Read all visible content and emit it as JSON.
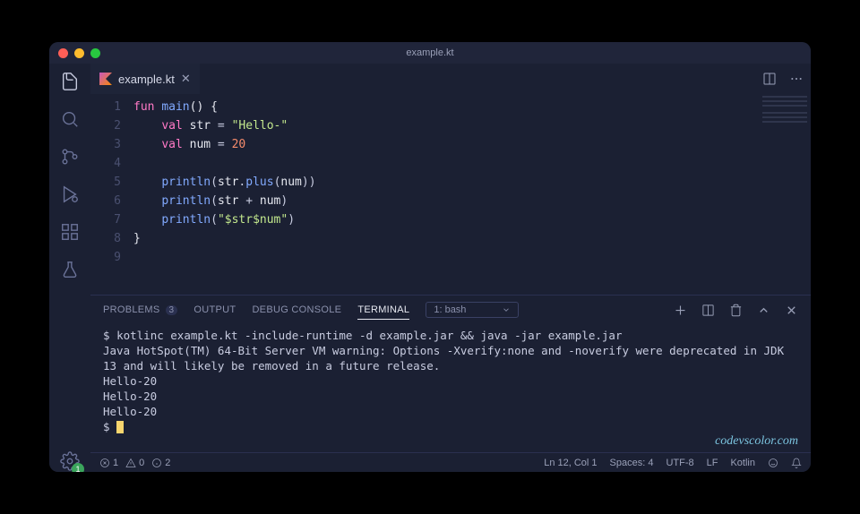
{
  "window": {
    "title": "example.kt"
  },
  "tab": {
    "filename": "example.kt"
  },
  "code": {
    "lines": [
      {
        "n": "1",
        "html": "<span class='kw'>fun</span> <span class='fn'>main</span><span class='id'>() {</span>"
      },
      {
        "n": "2",
        "html": "<span class='ind'>    </span><span class='kw'>val</span> <span class='id'>str</span> = <span class='str'>\"Hello-\"</span>"
      },
      {
        "n": "3",
        "html": "<span class='ind'>    </span><span class='kw'>val</span> <span class='id'>num</span> = <span class='num'>20</span>"
      },
      {
        "n": "4",
        "html": ""
      },
      {
        "n": "5",
        "html": "<span class='ind'>    </span><span class='fn'>println</span>(<span class='id'>str</span>.<span class='fn'>plus</span>(<span class='id'>num</span>))"
      },
      {
        "n": "6",
        "html": "<span class='ind'>    </span><span class='fn'>println</span>(<span class='id'>str</span> + <span class='id'>num</span>)"
      },
      {
        "n": "7",
        "html": "<span class='ind'>    </span><span class='fn'>println</span>(<span class='str'>\"$str$num\"</span>)"
      },
      {
        "n": "8",
        "html": "<span class='id'>}</span>"
      },
      {
        "n": "9",
        "html": ""
      }
    ]
  },
  "panel": {
    "tabs": {
      "problems": "PROBLEMS",
      "problems_count": "3",
      "output": "OUTPUT",
      "debug": "DEBUG CONSOLE",
      "terminal": "TERMINAL"
    },
    "shell": "1: bash"
  },
  "terminal": {
    "prompt": "$",
    "cmd": "kotlinc example.kt -include-runtime -d example.jar && java -jar example.jar",
    "warn": "Java HotSpot(TM) 64-Bit Server VM warning: Options -Xverify:none and -noverify were deprecated in JDK 13 and will likely be removed in a future release.",
    "out1": "Hello-20",
    "out2": "Hello-20",
    "out3": "Hello-20"
  },
  "watermark": "codevscolor.com",
  "status": {
    "errors": "1",
    "warnings": "0",
    "info": "2",
    "lncol": "Ln 12, Col 1",
    "spaces": "Spaces: 4",
    "encoding": "UTF-8",
    "eol": "LF",
    "lang": "Kotlin"
  },
  "activity_badge": "1"
}
